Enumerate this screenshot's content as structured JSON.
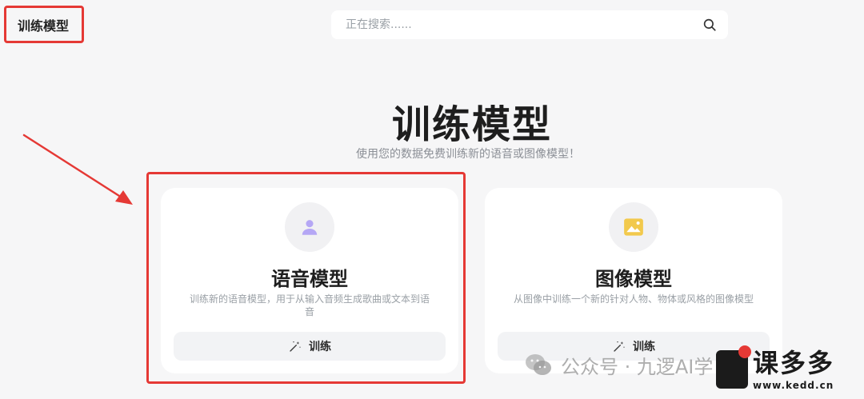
{
  "header": {
    "page_label": "训练模型",
    "search_placeholder": "正在搜索......"
  },
  "hero": {
    "title": "训练模型",
    "subtitle": "使用您的数据免费训练新的语音或图像模型！"
  },
  "cards": [
    {
      "id": "voice",
      "icon": "user-icon",
      "icon_color": "#b5a7f5",
      "title": "语音模型",
      "description": "训练新的语音模型，用于从输入音频生成歌曲或文本到语音",
      "button_label": "训练"
    },
    {
      "id": "image",
      "icon": "image-icon",
      "icon_color": "#f2c94c",
      "title": "图像模型",
      "description": "从图像中训练一个新的针对人物、物体或风格的图像模型",
      "button_label": "训练"
    }
  ],
  "watermark": {
    "text": "公众号 · 九逻AI学",
    "logo_text": "课多多",
    "logo_url_text": "www.kedd.cn"
  },
  "colors": {
    "highlight": "#e53935",
    "background": "#f6f6f7"
  }
}
